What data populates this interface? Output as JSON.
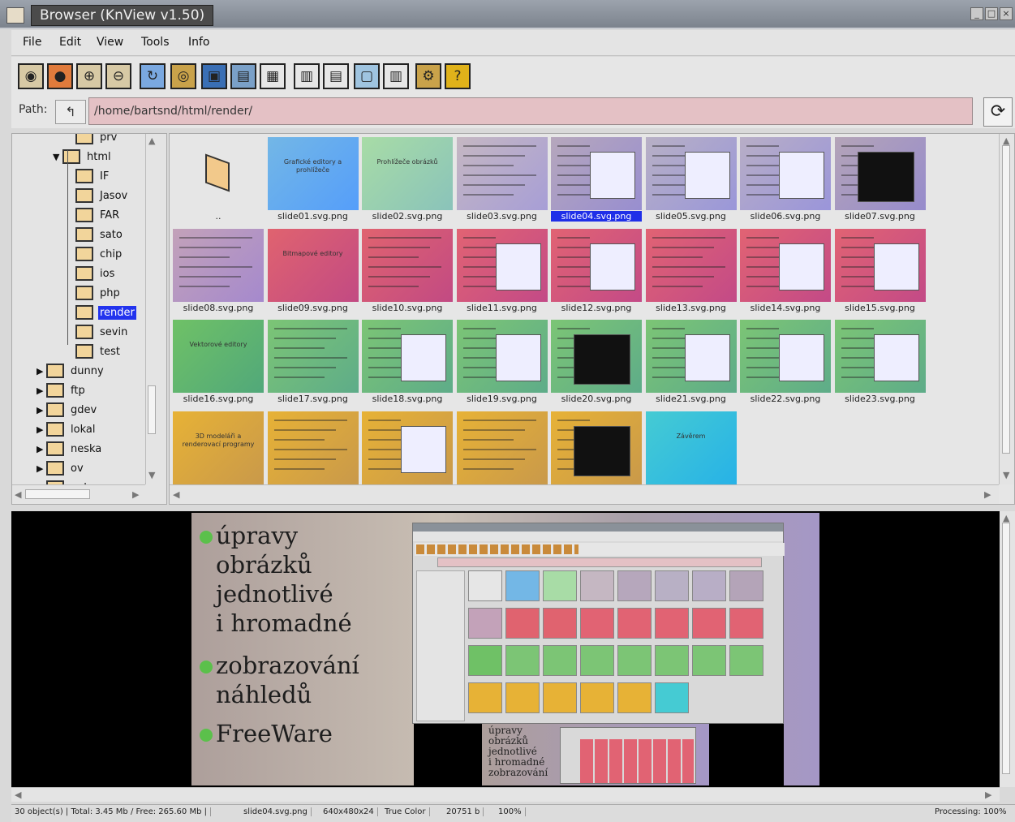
{
  "window": {
    "title": "Browser (KnView v1.50)"
  },
  "menu": [
    "File",
    "Edit",
    "View",
    "Tools",
    "Info"
  ],
  "toolbar_icons": [
    "display-icon",
    "stop-icon",
    "zoom-in-icon",
    "zoom-out-icon",
    "rotate-icon",
    "slideshow-icon",
    "screen-icon",
    "monitor-icon",
    "list-view-icon",
    "thumb-small-icon",
    "thumb-medium-icon",
    "thumb-large-icon",
    "details-icon",
    "settings-icon",
    "help-icon"
  ],
  "path": {
    "label": "Path:",
    "value": "/home/bartsnd/html/render/",
    "up_glyph": "↰",
    "refresh_glyph": "⟳"
  },
  "tree": [
    {
      "label": "prv",
      "indent": 3,
      "kind": "partial"
    },
    {
      "label": "html",
      "indent": 2,
      "kind": "expanded"
    },
    {
      "label": "IF",
      "indent": 3
    },
    {
      "label": "Jasov",
      "indent": 3
    },
    {
      "label": "FAR",
      "indent": 3
    },
    {
      "label": "sato",
      "indent": 3
    },
    {
      "label": "chip",
      "indent": 3
    },
    {
      "label": "ios",
      "indent": 3
    },
    {
      "label": "php",
      "indent": 3
    },
    {
      "label": "render",
      "indent": 3,
      "selected": true
    },
    {
      "label": "sevin",
      "indent": 3
    },
    {
      "label": "test",
      "indent": 3
    },
    {
      "label": "dunny",
      "indent": 1,
      "kind": "collapsed"
    },
    {
      "label": "ftp",
      "indent": 1,
      "kind": "collapsed"
    },
    {
      "label": "gdev",
      "indent": 1,
      "kind": "collapsed"
    },
    {
      "label": "lokal",
      "indent": 1,
      "kind": "collapsed"
    },
    {
      "label": "neska",
      "indent": 1,
      "kind": "collapsed"
    },
    {
      "label": "ov",
      "indent": 1,
      "kind": "collapsed"
    },
    {
      "label": "pelnon",
      "indent": 1,
      "kind": "collapsed"
    }
  ],
  "thumbnails": [
    {
      "name": "..",
      "bg": "#e6e6e6",
      "kind": "folder"
    },
    {
      "name": "slide01.svg.png",
      "bg": "#73b7e6",
      "kind": "text",
      "text": "Grafické editory a prohlížeče"
    },
    {
      "name": "slide02.svg.png",
      "bg": "#a8dca6",
      "kind": "text",
      "text": "Prohlížeče obrázků"
    },
    {
      "name": "slide03.svg.png",
      "bg": "#c5b7c2",
      "kind": "lines"
    },
    {
      "name": "slide04.svg.png",
      "bg": "#b6a7bc",
      "kind": "shot",
      "selected": true
    },
    {
      "name": "slide05.svg.png",
      "bg": "#b8b0c5",
      "kind": "shot"
    },
    {
      "name": "slide06.svg.png",
      "bg": "#b8aec6",
      "kind": "shot"
    },
    {
      "name": "slide07.svg.png",
      "bg": "#b4a4b8",
      "kind": "shot2"
    },
    {
      "name": "slide08.svg.png",
      "bg": "#c3a2b9",
      "kind": "lines"
    },
    {
      "name": "slide09.svg.png",
      "bg": "#e0636f",
      "kind": "text",
      "text": "Bitmapové editory"
    },
    {
      "name": "slide10.svg.png",
      "bg": "#e0636f",
      "kind": "lines"
    },
    {
      "name": "slide11.svg.png",
      "bg": "#e16373",
      "kind": "shot"
    },
    {
      "name": "slide12.svg.png",
      "bg": "#e16373",
      "kind": "shot"
    },
    {
      "name": "slide13.svg.png",
      "bg": "#e16373",
      "kind": "lines"
    },
    {
      "name": "slide14.svg.png",
      "bg": "#e16373",
      "kind": "shot"
    },
    {
      "name": "slide15.svg.png",
      "bg": "#e16373",
      "kind": "shot"
    },
    {
      "name": "slide16.svg.png",
      "bg": "#6fc166",
      "kind": "text",
      "text": "Vektorové editory"
    },
    {
      "name": "slide17.svg.png",
      "bg": "#7cc575",
      "kind": "lines"
    },
    {
      "name": "slide18.svg.png",
      "bg": "#7cc575",
      "kind": "shot"
    },
    {
      "name": "slide19.svg.png",
      "bg": "#7cc575",
      "kind": "shot"
    },
    {
      "name": "slide20.svg.png",
      "bg": "#7cc575",
      "kind": "shot2"
    },
    {
      "name": "slide21.svg.png",
      "bg": "#7cc575",
      "kind": "shot"
    },
    {
      "name": "slide22.svg.png",
      "bg": "#7cc575",
      "kind": "shot"
    },
    {
      "name": "slide23.svg.png",
      "bg": "#7cc575",
      "kind": "shot"
    },
    {
      "name": "",
      "bg": "#e7b236",
      "kind": "text",
      "text": "3D modeláři a renderovací programy"
    },
    {
      "name": "",
      "bg": "#e7b236",
      "kind": "lines"
    },
    {
      "name": "",
      "bg": "#e7b236",
      "kind": "shot"
    },
    {
      "name": "",
      "bg": "#e7b236",
      "kind": "lines"
    },
    {
      "name": "",
      "bg": "#e7b236",
      "kind": "shot2"
    },
    {
      "name": "",
      "bg": "#45cbd3",
      "kind": "text",
      "text": "Závěrem"
    }
  ],
  "preview": {
    "bullets": [
      {
        "lines": [
          "úpravy",
          "obrázků",
          "jednotlivé",
          "i hromadné"
        ]
      },
      {
        "lines": [
          "zobrazování",
          "náhledů"
        ]
      },
      {
        "lines": [
          "FreeWare"
        ]
      }
    ],
    "mini_text": [
      "úpravy",
      "obrázků",
      "jednotlivé",
      "i hromadné",
      "zobrazování"
    ]
  },
  "status": {
    "objects": "30 object(s) | Total: 3.45 Mb / Free: 265.60 Mb |",
    "file": "slide04.svg.png",
    "dims": "640x480x24",
    "color": "True Color",
    "size": "20751 b",
    "zoom": "100%",
    "processing": "Processing: 100%"
  },
  "colors": {
    "accent": "#1f2fe8",
    "path_field": "#e4c1c5",
    "bullet": "#5bc04b"
  }
}
